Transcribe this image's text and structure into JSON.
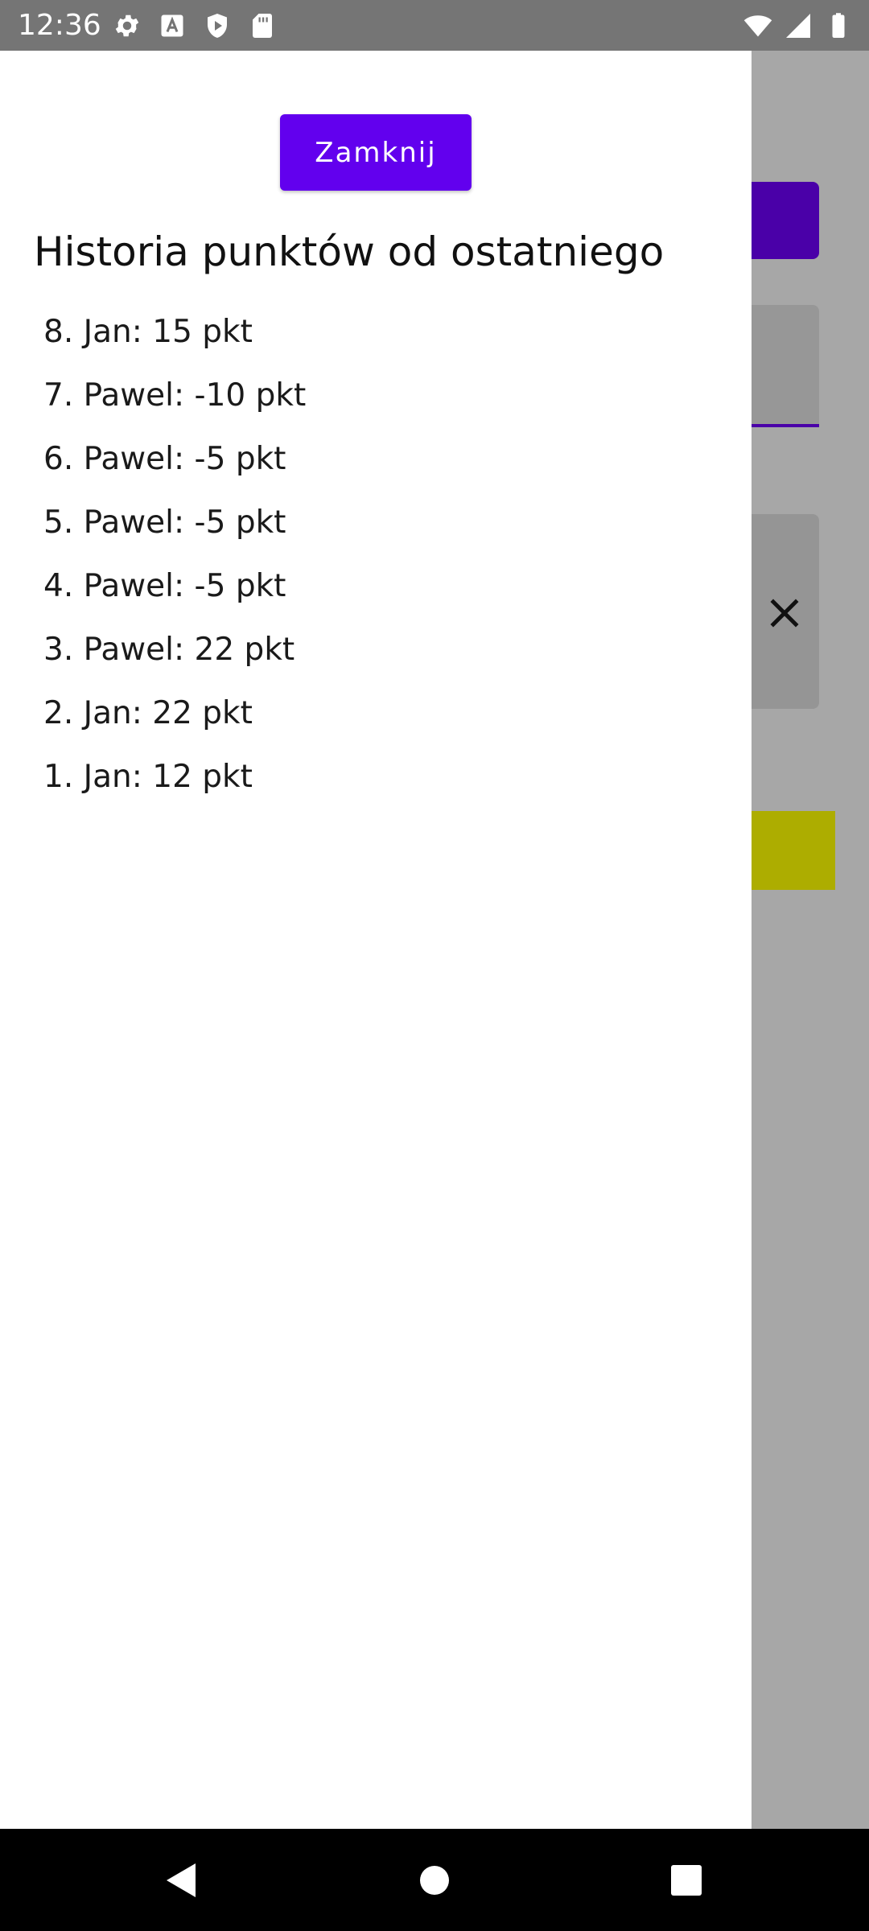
{
  "status_bar": {
    "time": "12:36",
    "left_icons": [
      "settings-icon",
      "font-a-icon",
      "shield-play-icon",
      "sd-card-icon"
    ],
    "right_icons": [
      "wifi-icon",
      "signal-icon",
      "battery-icon"
    ]
  },
  "drawer": {
    "close_button_label": "Zamknij",
    "title": "Historia punktów od ostatniego",
    "history": [
      "8. Jan: 15 pkt",
      "7. Pawel: -10 pkt",
      "6. Pawel: -5 pkt",
      "5. Pawel: -5 pkt",
      "4. Pawel: -5 pkt",
      "3. Pawel: 22 pkt",
      "2. Jan: 22 pkt",
      "1. Jan: 12 pkt"
    ]
  },
  "colors": {
    "accent": "#6200ee",
    "status_bar": "#757575",
    "scrim": "#a7a7a7",
    "yellow": "#adad00"
  },
  "nav_bar": {
    "buttons": [
      "back-icon",
      "home-icon",
      "recents-icon"
    ]
  }
}
